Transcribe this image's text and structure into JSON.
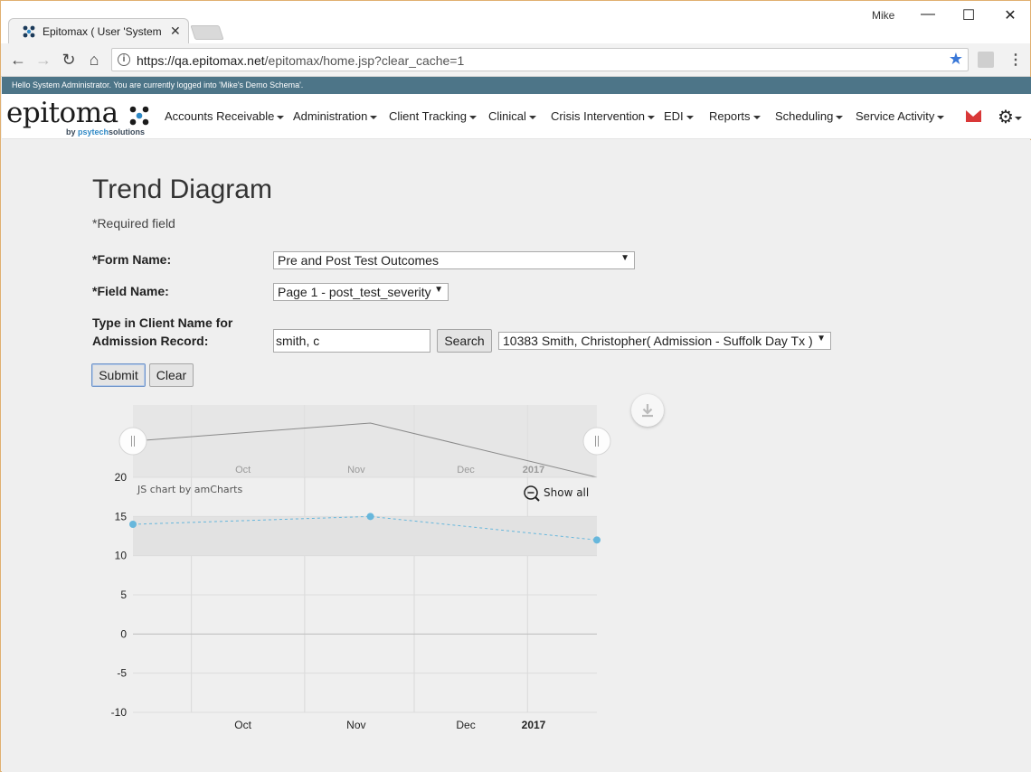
{
  "browser": {
    "tab_title": "Epitomax ( User 'System",
    "user": "Mike",
    "url_host": "https://qa.epitomax.net",
    "url_path": "/epitomax/home.jsp?clear_cache=1"
  },
  "app": {
    "greeting": "Hello System Administrator. You are currently logged into 'Mike's Demo Schema'.",
    "logo_word": "epitoma",
    "logo_by": "by ",
    "logo_company_a": "psytech",
    "logo_company_b": "solutions",
    "menu": [
      "Accounts Receivable",
      "Administration",
      "Client Tracking",
      "Clinical",
      "Crisis Intervention",
      "EDI",
      "Reports",
      "Scheduling",
      "Service Activity"
    ]
  },
  "page": {
    "title": "Trend Diagram",
    "required_note": "*Required field",
    "form_name_label": "*Form Name:",
    "form_name_value": "Pre and Post Test Outcomes",
    "field_name_label": "*Field Name:",
    "field_name_value": "Page 1 - post_test_severity",
    "client_label_line1": "Type in Client Name for",
    "client_label_line2": "Admission Record:",
    "client_search_value": "smith, c",
    "search_button": "Search",
    "admission_value": "10383 Smith, Christopher( Admission - Suffolk Day Tx )",
    "submit_button": "Submit",
    "clear_button": "Clear"
  },
  "chart_data": {
    "type": "line",
    "credit": "JS chart by amCharts",
    "show_all_label": "Show all",
    "x_ticks": [
      "Oct",
      "Nov",
      "Dec",
      "2017"
    ],
    "x": [
      "2016-09-15",
      "2016-11-19",
      "2017-01-20"
    ],
    "series": [
      {
        "values": [
          14,
          15,
          12
        ]
      }
    ],
    "y_ticks": [
      20,
      15,
      10,
      5,
      0,
      -5,
      -10
    ],
    "ylim": [
      -10,
      20
    ],
    "guide_band": [
      10,
      15
    ],
    "line_color": "#67b7dc",
    "grid": true
  }
}
